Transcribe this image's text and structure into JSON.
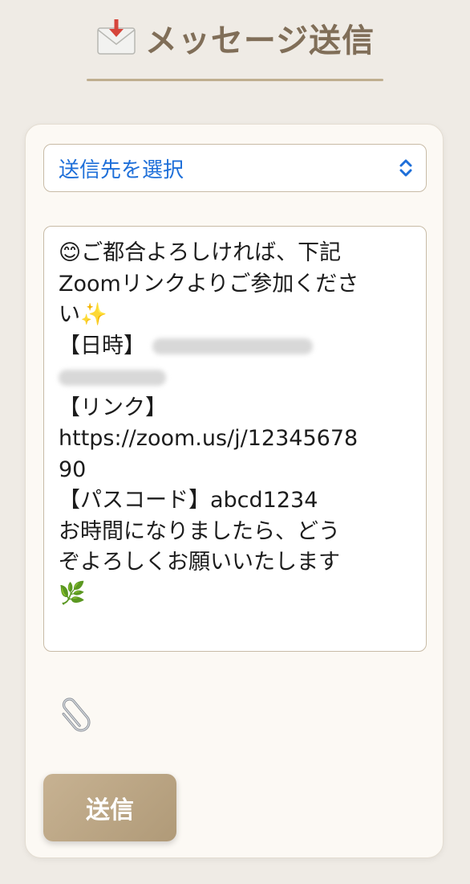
{
  "header": {
    "icon": "envelope-icon",
    "title": "メッセージ送信"
  },
  "recipient_select": {
    "label": "送信先を選択",
    "icon": "chevrons-up-down-icon",
    "color": "#1e6fd9"
  },
  "message": {
    "lines": {
      "l1": "😊ご都合よろしければ、下記",
      "l2": "Zoomリンクよりご参加くださ",
      "l3": "い✨",
      "l4": "【日時】",
      "l6": "【リンク】",
      "l7": "https://zoom.us/j/12345678",
      "l8": "90",
      "l9": "【パスコード】abcd1234",
      "l10": "お時間になりましたら、どう",
      "l11": "ぞよろしくお願いいたします",
      "l12": "🌿"
    }
  },
  "attachment": {
    "icon": "paperclip-icon"
  },
  "send_button": {
    "label": "送信"
  },
  "colors": {
    "background": "#efebe5",
    "card": "#fcf9f4",
    "title": "#806e58",
    "accent": "#b09a78"
  }
}
